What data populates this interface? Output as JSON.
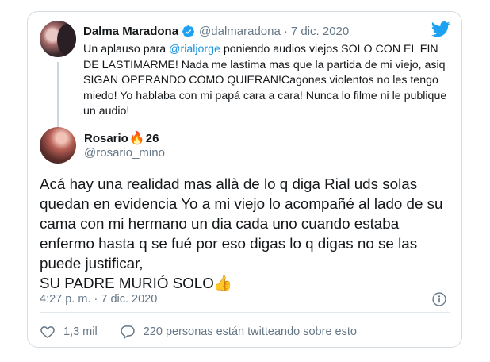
{
  "quoted": {
    "name": "Dalma Maradona",
    "handle": "@dalmaradona",
    "separator": "·",
    "date": "7 dic. 2020",
    "text_before": "Un aplauso para ",
    "mention": "@rialjorge",
    "text_after": " poniendo audios viejos SOLO CON EL FIN DE LASTIMARME! Nada me lastima mas que la partida de mi viejo, asiq SIGAN OPERANDO COMO QUIERAN!Cagones violentos no les tengo miedo! Yo hablaba con mi papá cara a cara! Nunca lo filme ni le publique un audio!"
  },
  "tweet": {
    "name_prefix": "Rosario",
    "name_emoji": "🔥",
    "name_suffix": "26",
    "handle": "@rosario_mino",
    "body": "Acá hay una realidad mas allà de lo q diga Rial uds solas quedan en evidencia Yo a mi viejo lo acompañé al lado de su cama con mi hermano un dia cada uno cuando estaba enfermo hasta q se fué por eso digas lo q digas no se las puede justificar,",
    "body_last": "SU PADRE MURIÓ SOLO",
    "body_emoji": "👍",
    "timestamp": "4:27 p. m. · 7 dic. 2020"
  },
  "actions": {
    "likes": "1,3 mil",
    "replies_text": "220 personas están twitteando sobre esto"
  },
  "icons": {
    "verified": "verified-badge-icon",
    "brand": "twitter-bird-icon",
    "info": "info-icon",
    "like": "heart-icon",
    "reply": "comment-icon"
  },
  "colors": {
    "brand": "#1DA1F2",
    "link": "#1B95E0",
    "muted": "#657786"
  }
}
